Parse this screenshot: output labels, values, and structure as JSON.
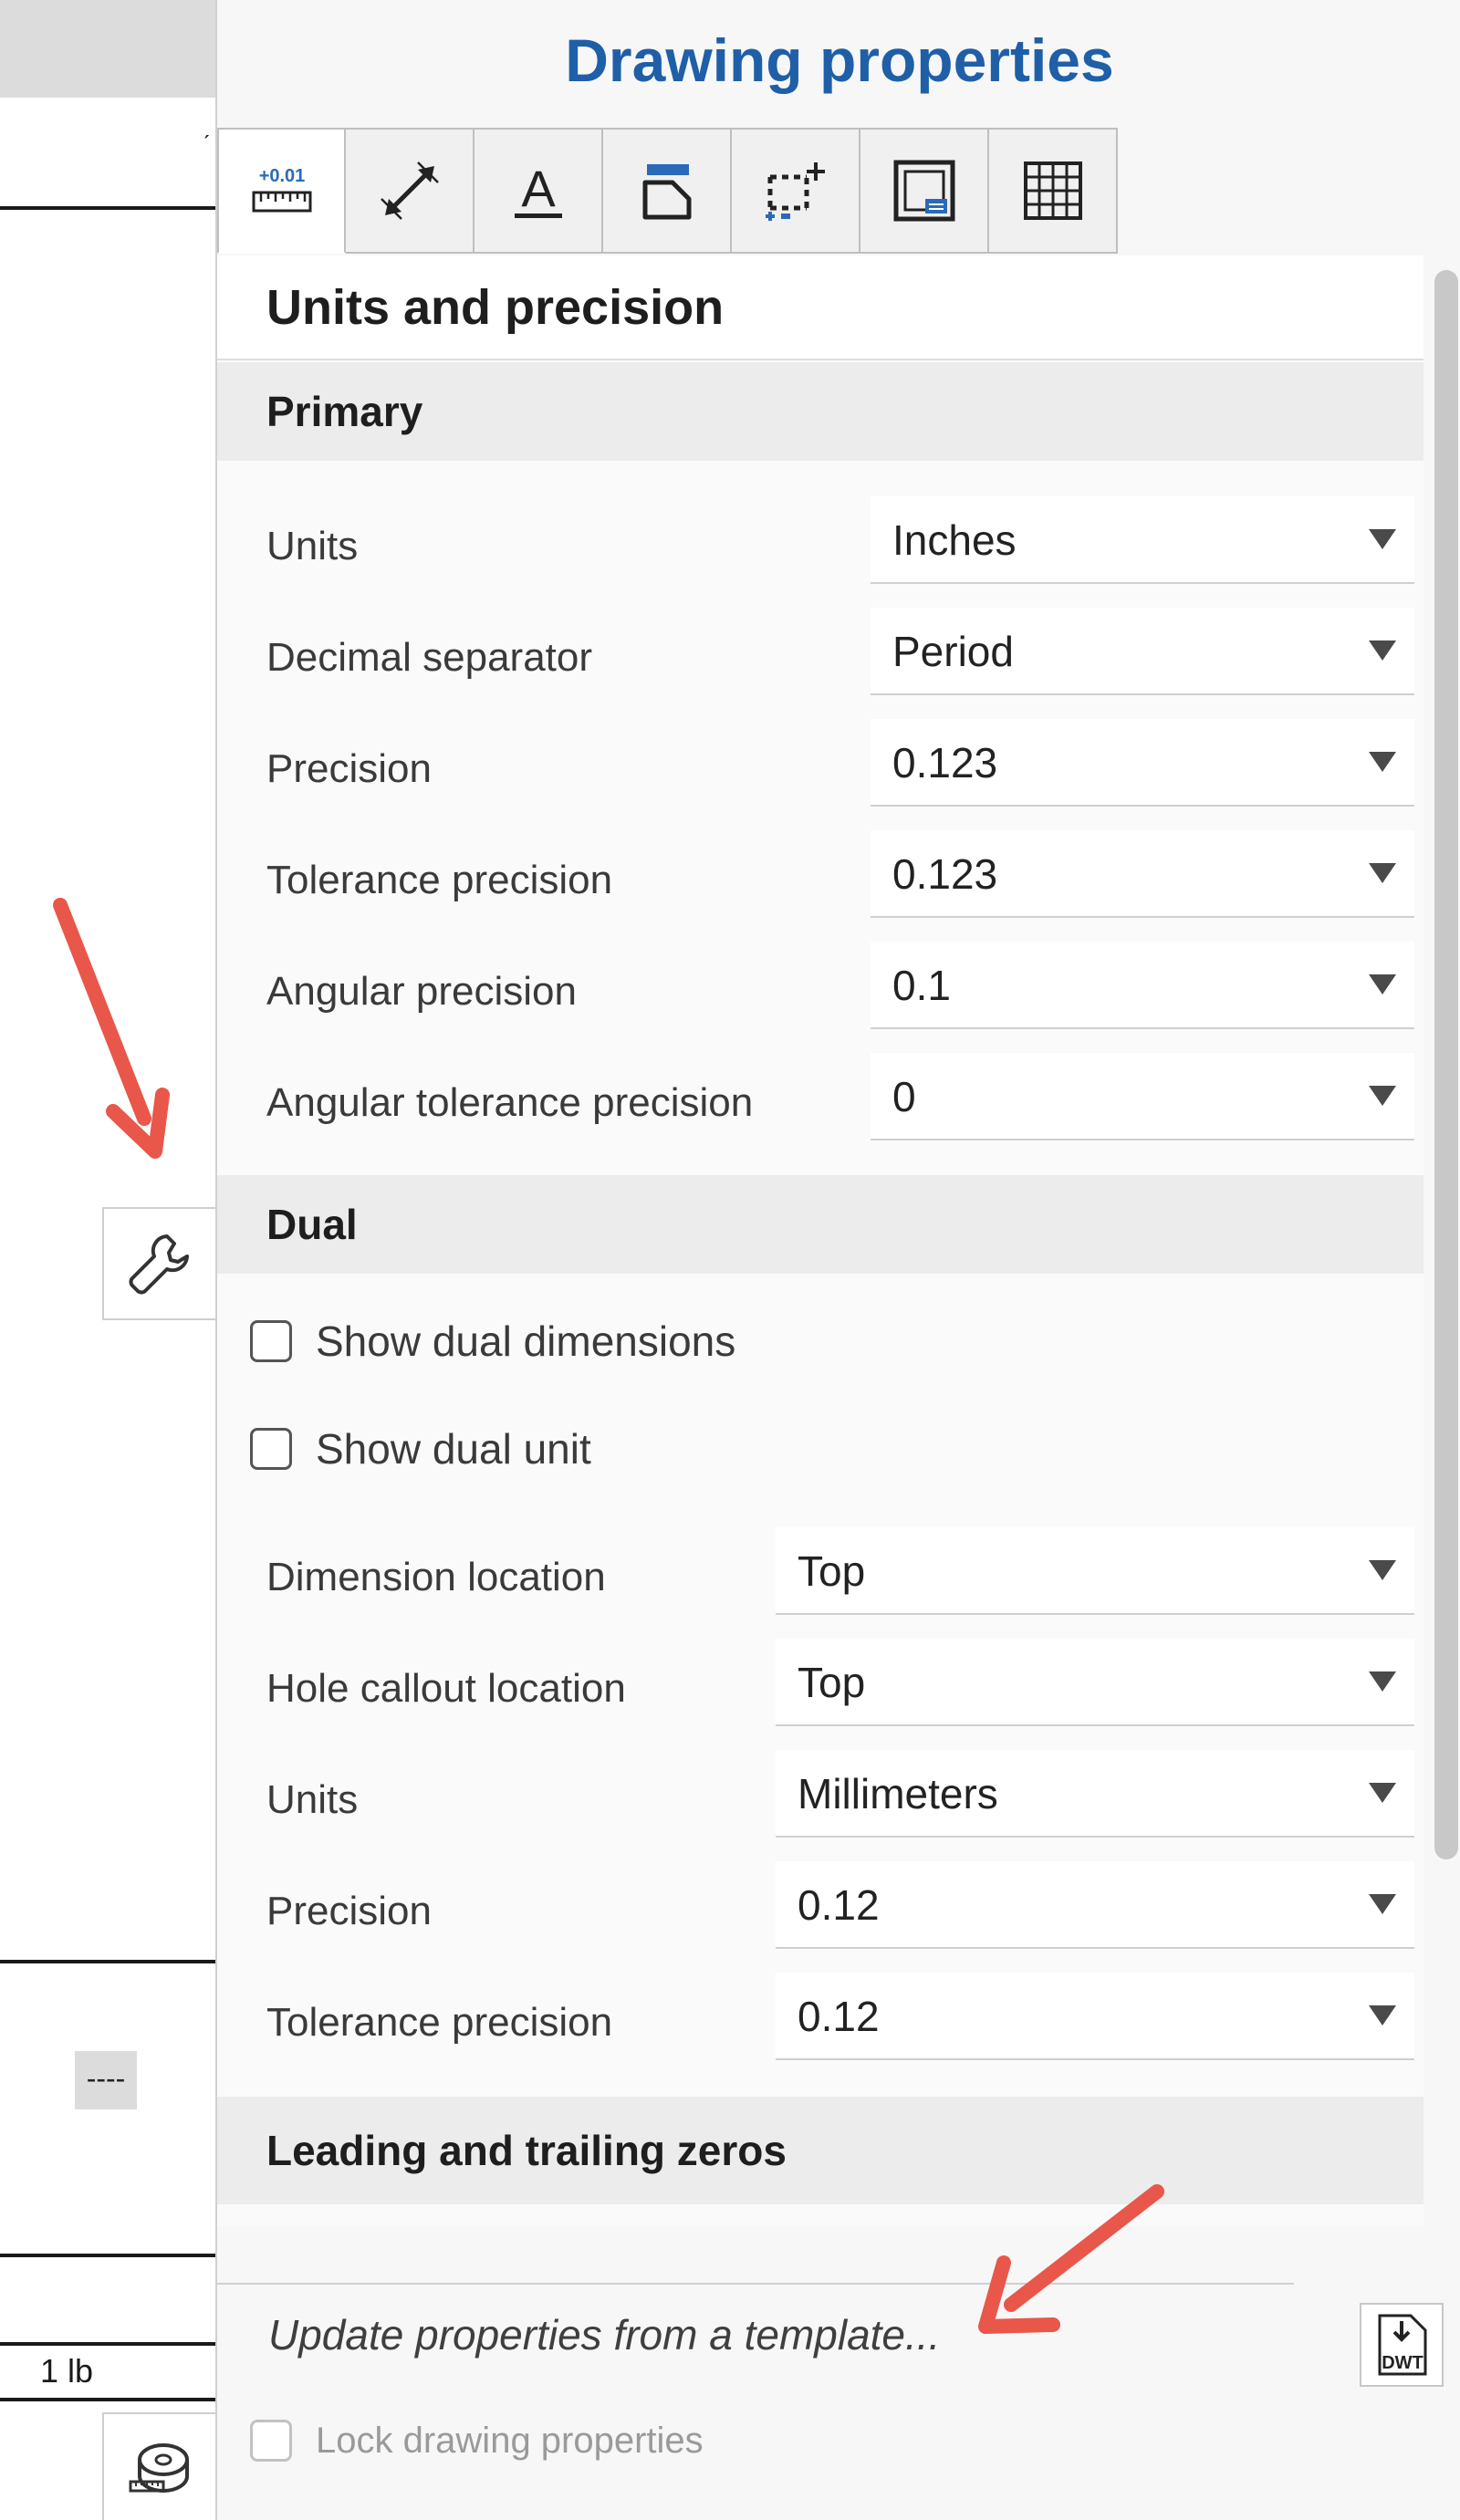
{
  "panel": {
    "title": "Drawing properties",
    "tabs": [
      {
        "icon": "units-precision-icon",
        "label": "+0.01",
        "active": true
      },
      {
        "icon": "dimension-arrow-icon",
        "active": false
      },
      {
        "icon": "text-icon",
        "label": "A",
        "active": false
      },
      {
        "icon": "callout-icon",
        "active": false
      },
      {
        "icon": "frame-add-icon",
        "active": false
      },
      {
        "icon": "border-icon",
        "active": false
      },
      {
        "icon": "table-grid-icon",
        "active": false
      }
    ]
  },
  "section": {
    "title": "Units and precision",
    "primary": {
      "heading": "Primary",
      "rows": [
        {
          "label": "Units",
          "value": "Inches"
        },
        {
          "label": "Decimal separator",
          "value": "Period"
        },
        {
          "label": "Precision",
          "value": "0.123"
        },
        {
          "label": "Tolerance precision",
          "value": "0.123"
        },
        {
          "label": "Angular precision",
          "value": "0.1"
        },
        {
          "label": "Angular tolerance precision",
          "value": "0"
        }
      ]
    },
    "dual": {
      "heading": "Dual",
      "checks": [
        {
          "label": "Show dual dimensions",
          "checked": false
        },
        {
          "label": "Show dual unit",
          "checked": false
        }
      ],
      "rows": [
        {
          "label": "Dimension location",
          "value": "Top"
        },
        {
          "label": "Hole callout location",
          "value": "Top"
        },
        {
          "label": "Units",
          "value": "Millimeters"
        },
        {
          "label": "Precision",
          "value": "0.12"
        },
        {
          "label": "Tolerance precision",
          "value": "0.12"
        }
      ]
    },
    "zeros": {
      "heading": "Leading and trailing zeros"
    }
  },
  "footer": {
    "template_link": "Update properties from a template...",
    "dwt_label": "DWT",
    "lock_label": "Lock drawing properties"
  },
  "canvas": {
    "dash_text": "----",
    "weight_text": "1 lb"
  },
  "colors": {
    "title_blue": "#1f5fa8",
    "icon_blue": "#2a6ab8",
    "annotation_arrow": "#e8574a"
  }
}
